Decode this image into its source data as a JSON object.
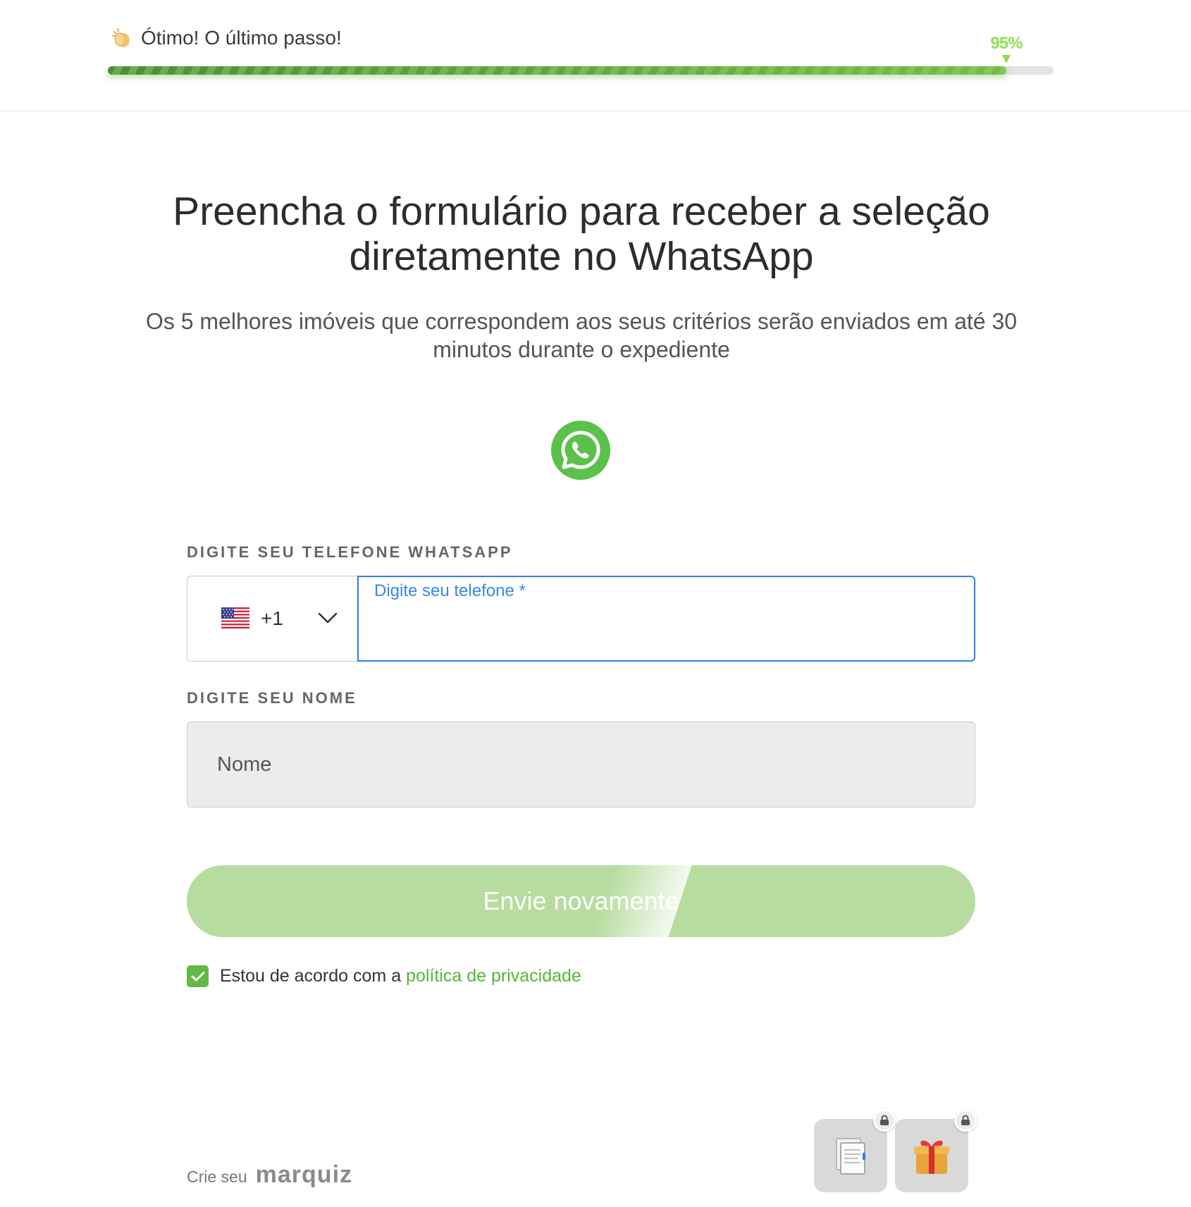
{
  "header": {
    "step_text": "Ótimo! O último passo!",
    "progress_percent": 95,
    "progress_label": "95%",
    "progress_color": "#8ee04f"
  },
  "main": {
    "title": "Preencha o formulário para receber a seleção diretamente no WhatsApp",
    "subtitle": "Os 5 melhores imóveis que correspondem aos seus critérios serão enviados em até 30 minutos durante o expediente",
    "logo_icon": "whatsapp-icon",
    "brand_color": "#5bc14a"
  },
  "form": {
    "phone_label": "DIGITE SEU TELEFONE WHATSAPP",
    "country_flag": "us-flag-icon",
    "dial_code": "+1",
    "phone_placeholder": "Digite seu telefone *",
    "phone_value": "",
    "name_label": "DIGITE SEU NOME",
    "name_placeholder": "Nome",
    "name_value": "",
    "submit_label": "Envie novamente",
    "consent_text": "Estou de acordo com a ",
    "consent_link": "política de privacidade",
    "consent_checked": true
  },
  "footer": {
    "crie_text": "Crie seu",
    "brand": "marquiz",
    "bonuses": [
      {
        "icon": "document-icon",
        "locked": true
      },
      {
        "icon": "gift-icon",
        "locked": true
      }
    ]
  }
}
